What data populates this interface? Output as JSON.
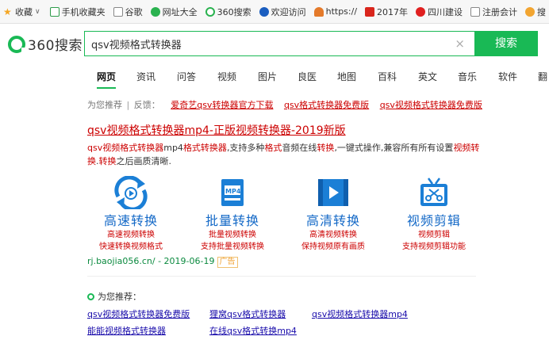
{
  "bookmarks": [
    {
      "label": "收藏",
      "icon": "star-icon",
      "dropdown": true
    },
    {
      "label": "手机收藏夹",
      "icon": "mobile-icon"
    },
    {
      "label": "谷歌",
      "icon": "document-icon"
    },
    {
      "label": "网址大全",
      "icon": "green-globe-icon"
    },
    {
      "label": "360搜索",
      "icon": "360-logo-icon"
    },
    {
      "label": "欢迎访问",
      "icon": "blue-globe-icon"
    },
    {
      "label": "https://",
      "icon": "person-icon"
    },
    {
      "label": "2017年",
      "icon": "red-page-icon"
    },
    {
      "label": "四川建设",
      "icon": "emblem-icon"
    },
    {
      "label": "注册会计",
      "icon": "document-icon"
    },
    {
      "label": "搜",
      "icon": "sogou-icon"
    }
  ],
  "header": {
    "logo_text": "360搜索",
    "query": "qsv视频格式转换器",
    "clear_glyph": "×",
    "search_label": "搜索"
  },
  "tabs": [
    "网页",
    "资讯",
    "问答",
    "视频",
    "图片",
    "良医",
    "地图",
    "百科",
    "英文",
    "音乐",
    "软件",
    "翻"
  ],
  "recommend": {
    "prefix": "为您推荐",
    "sep": "|",
    "feedback": "反馈：",
    "links": [
      "爱奇艺qsv转换器官方下载",
      "qsv格式转换器免费版",
      "qsv视频格式转换器免费版"
    ]
  },
  "ad": {
    "title": "qsv视频格式转换器mp4-正版视频转换器-2019新版",
    "desc_parts": [
      {
        "t": "qsv视频格式转换器",
        "hl": true
      },
      {
        "t": "mp4",
        "hl": false
      },
      {
        "t": "格式转换器",
        "hl": true
      },
      {
        "t": ",支持多种",
        "hl": false
      },
      {
        "t": "格式",
        "hl": true
      },
      {
        "t": "音频在线",
        "hl": false
      },
      {
        "t": "转换",
        "hl": true
      },
      {
        "t": ",一键式操作,兼容所有所有设置",
        "hl": false
      },
      {
        "t": "视频转换",
        "hl": true
      },
      {
        "t": ".",
        "hl": false
      },
      {
        "t": "转换",
        "hl": true
      },
      {
        "t": "之后画质清晰.",
        "hl": false
      }
    ],
    "features": [
      {
        "title": "高速转换",
        "sub1": "高速视频转换",
        "sub2": "快速转换视频格式",
        "icon": "circular-arrows-icon"
      },
      {
        "title": "批量转换",
        "sub1": "批量视频转换",
        "sub2": "支持批量视频转换",
        "icon": "mp4-file-icon"
      },
      {
        "title": "高清转换",
        "sub1": "高清视频转换",
        "sub2": "保持视频原有画质",
        "icon": "video-play-icon"
      },
      {
        "title": "视频剪辑",
        "sub1": "视频剪辑",
        "sub2": "支持视频剪辑功能",
        "icon": "tv-scissors-icon"
      }
    ],
    "url": "rj.baojia056.cn/ - 2019-06-19",
    "tag": "广告"
  },
  "related": {
    "heading": "为您推荐：",
    "links": [
      "qsv视频格式转换器免费版",
      "狸窝qsv格式转换器",
      "qsv视频格式转换器mp4",
      "能能视频格式转换器",
      "在线qsv格式转换mp4"
    ]
  },
  "colors": {
    "brand": "#19b955",
    "link": "#1a0dab",
    "ad_red": "#cc0000",
    "feature_blue": "#1469c7"
  }
}
